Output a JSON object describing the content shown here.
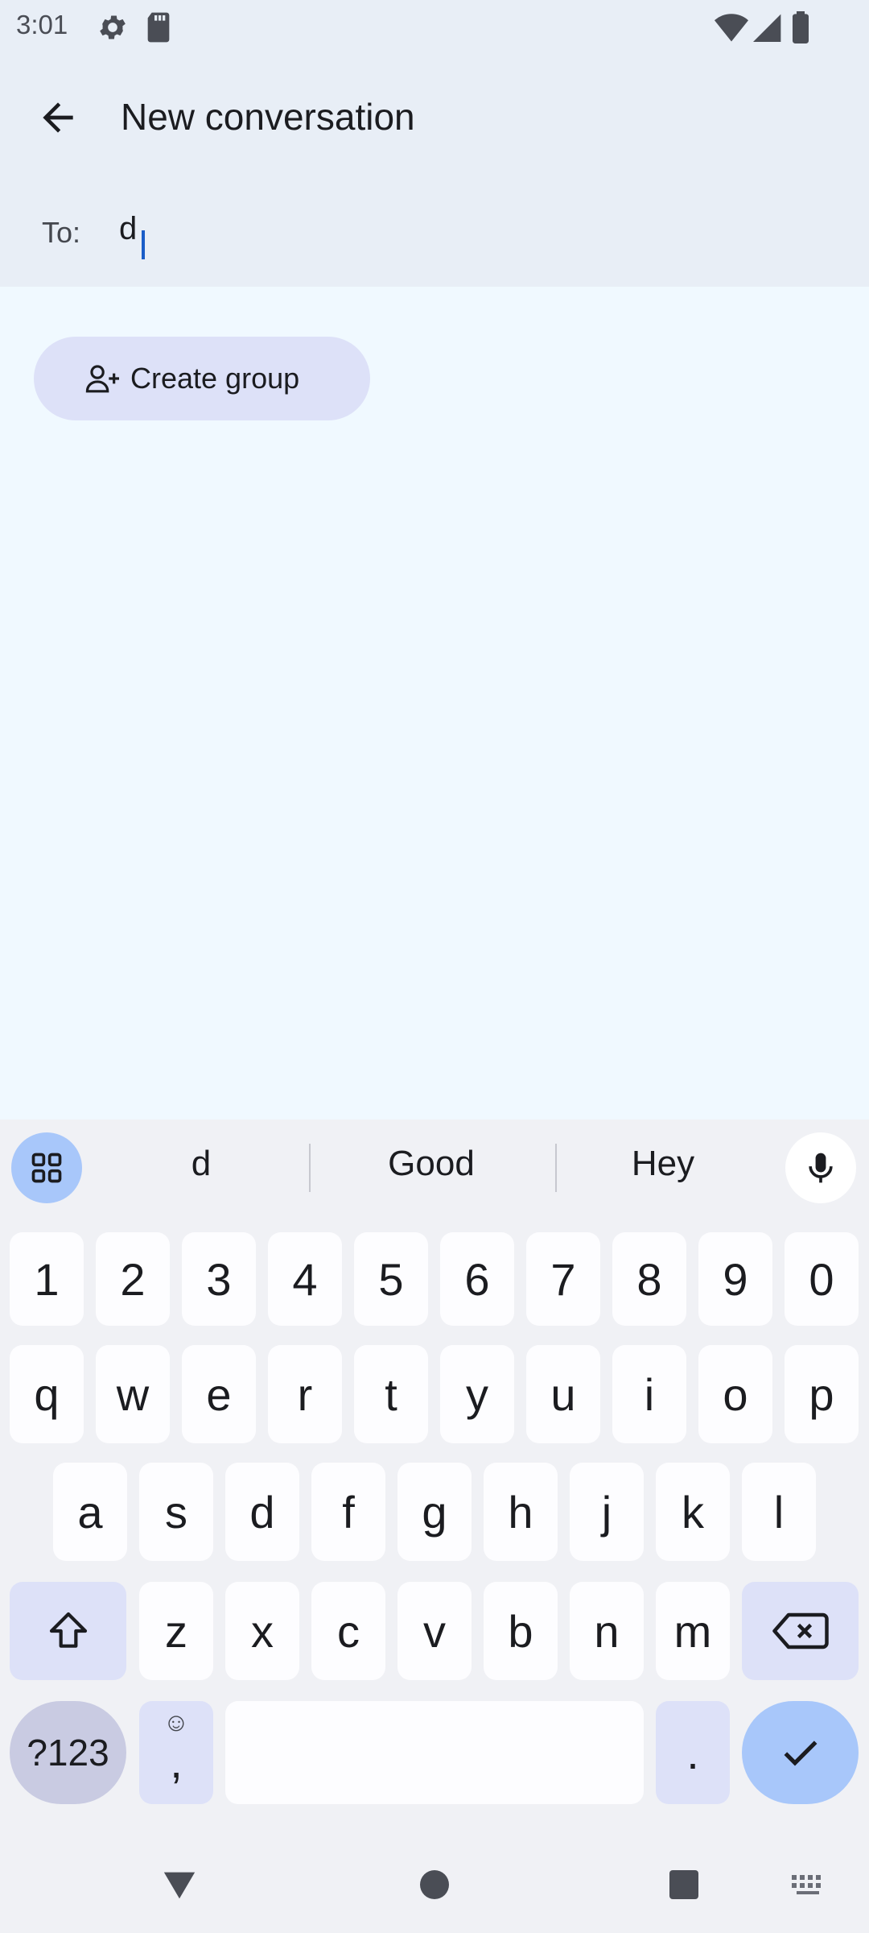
{
  "status_bar": {
    "time": "3:01"
  },
  "app_bar": {
    "title": "New conversation",
    "back_icon": "back-arrow-icon"
  },
  "recipient": {
    "to_label": "To:",
    "value": "d"
  },
  "actions": {
    "create_group_label": "Create group",
    "create_group_icon": "group-add-icon"
  },
  "keyboard": {
    "suggestions": [
      "d",
      "Good",
      "Hey"
    ],
    "number_row": [
      "1",
      "2",
      "3",
      "4",
      "5",
      "6",
      "7",
      "8",
      "9",
      "0"
    ],
    "row1": [
      "q",
      "w",
      "e",
      "r",
      "t",
      "y",
      "u",
      "i",
      "o",
      "p"
    ],
    "row2": [
      "a",
      "s",
      "d",
      "f",
      "g",
      "h",
      "j",
      "k",
      "l"
    ],
    "row3": [
      "z",
      "x",
      "c",
      "v",
      "b",
      "n",
      "m"
    ],
    "symbols_label": "?123",
    "comma_label": ",",
    "comma_hint": "☺",
    "period_label": "."
  },
  "colors": {
    "accent": "#a8c7fa",
    "mod_key": "#dde1f8",
    "caret": "#1a5dc8",
    "top_bg": "#e8eef6",
    "page_bg": "#f0f9ff"
  }
}
